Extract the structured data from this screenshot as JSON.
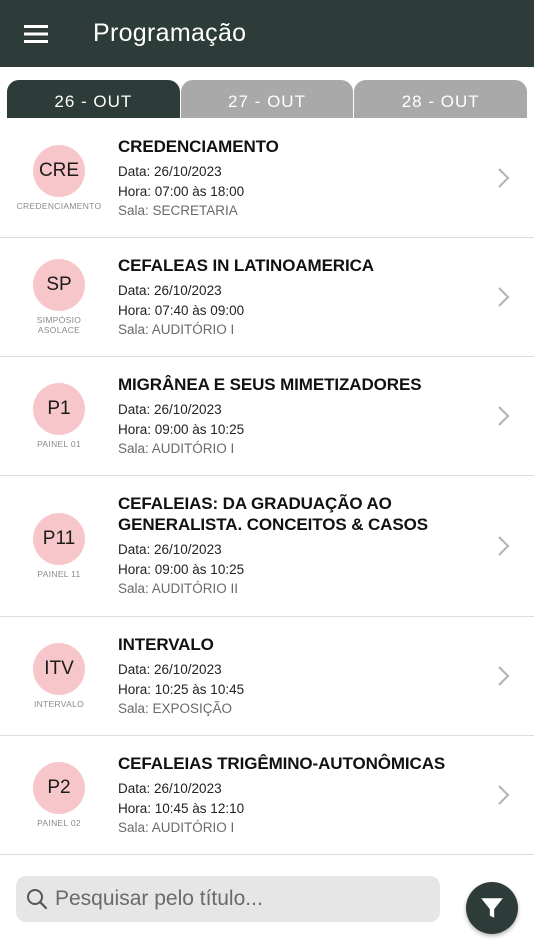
{
  "appbar": {
    "title": "Programação",
    "menu_icon": "menu-icon"
  },
  "tabs": [
    {
      "label": "26 - OUT",
      "active": true
    },
    {
      "label": "27 - OUT",
      "active": false
    },
    {
      "label": "28 - OUT",
      "active": false
    }
  ],
  "sessions": [
    {
      "badge": "CRE",
      "badge_sub": "CREDENCIAMENTO",
      "title": "CREDENCIAMENTO",
      "date": "Data: 26/10/2023",
      "time": "Hora: 07:00 às 18:00",
      "room": "Sala: SECRETARIA"
    },
    {
      "badge": "SP",
      "badge_sub": "SIMPÓSIO ASOLACE",
      "title": "CEFALEAS IN LATINOAMERICA",
      "date": "Data: 26/10/2023",
      "time": "Hora: 07:40 às 09:00",
      "room": "Sala: AUDITÓRIO I"
    },
    {
      "badge": "P1",
      "badge_sub": "PAINEL 01",
      "title": "MIGRÂNEA E SEUS MIMETIZADORES",
      "date": "Data: 26/10/2023",
      "time": "Hora: 09:00 às 10:25",
      "room": "Sala: AUDITÓRIO I"
    },
    {
      "badge": "P11",
      "badge_sub": "PAINEL 11",
      "title": "CEFALEIAS: DA GRADUAÇÃO AO GENERALISTA. CONCEITOS & CASOS",
      "date": "Data: 26/10/2023",
      "time": "Hora: 09:00 às 10:25",
      "room": "Sala: AUDITÓRIO II"
    },
    {
      "badge": "ITV",
      "badge_sub": "INTERVALO",
      "title": "INTERVALO",
      "date": "Data: 26/10/2023",
      "time": "Hora: 10:25 às 10:45",
      "room": "Sala: EXPOSIÇÃO"
    },
    {
      "badge": "P2",
      "badge_sub": "PAINEL 02",
      "title": "CEFALEIAS TRIGÊMINO-AUTONÔMICAS",
      "date": "Data: 26/10/2023",
      "time": "Hora: 10:45 às 12:10",
      "room": "Sala: AUDITÓRIO I"
    }
  ],
  "search": {
    "placeholder": "Pesquisar pelo título..."
  },
  "colors": {
    "appbar": "#2e3c39",
    "tab_inactive": "#a9a9a9",
    "badge_bg": "#f7c6ca",
    "search_bg": "#e6e6e6"
  }
}
